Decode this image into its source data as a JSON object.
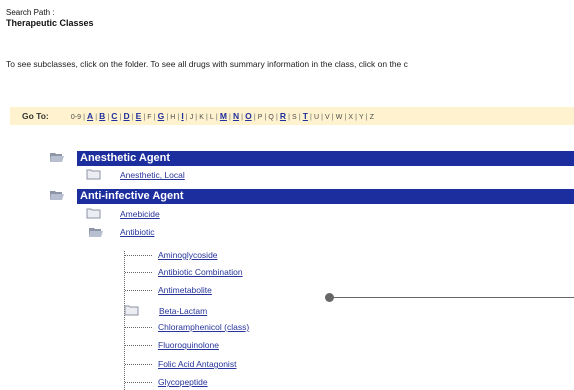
{
  "search_path": {
    "label": "Search Path :",
    "title": "Therapeutic Classes"
  },
  "instruction": "To see subclasses, click on the folder. To see all drugs with summary information in the class, click on the c",
  "goto": {
    "label": "Go To:",
    "letters": [
      {
        "text": "0-9",
        "active": false
      },
      {
        "text": "A",
        "active": true
      },
      {
        "text": "B",
        "active": true
      },
      {
        "text": "C",
        "active": true
      },
      {
        "text": "D",
        "active": true
      },
      {
        "text": "E",
        "active": true
      },
      {
        "text": "F",
        "active": false
      },
      {
        "text": "G",
        "active": true
      },
      {
        "text": "H",
        "active": false
      },
      {
        "text": "I",
        "active": true
      },
      {
        "text": "J",
        "active": false
      },
      {
        "text": "K",
        "active": false
      },
      {
        "text": "L",
        "active": false
      },
      {
        "text": "M",
        "active": true
      },
      {
        "text": "N",
        "active": true
      },
      {
        "text": "O",
        "active": true
      },
      {
        "text": "P",
        "active": false
      },
      {
        "text": "Q",
        "active": false
      },
      {
        "text": "R",
        "active": true
      },
      {
        "text": "S",
        "active": false
      },
      {
        "text": "T",
        "active": true
      },
      {
        "text": "U",
        "active": false
      },
      {
        "text": "V",
        "active": false
      },
      {
        "text": "W",
        "active": false
      },
      {
        "text": "X",
        "active": false
      },
      {
        "text": "Y",
        "active": false
      },
      {
        "text": "Z",
        "active": false
      }
    ]
  },
  "tree": {
    "anesthetic": {
      "title": "Anesthetic Agent",
      "child": "Anesthetic, Local"
    },
    "anti_infective": {
      "title": "Anti-infective Agent",
      "amebicide": "Amebicide",
      "antibiotic": "Antibiotic",
      "subclasses": {
        "aminoglycoside": "Aminoglycoside",
        "antibiotic_combination": "Antibiotic Combination",
        "antimetabolite": "Antimetabolite",
        "beta_lactam": "Beta-Lactam",
        "chloramphenicol": "Chloramphenicol (class)",
        "fluoroquinolone": "Fluoroquinolone",
        "folic_acid": "Folic Acid Antagonist",
        "glycopeptide": "Glycopeptide"
      }
    }
  },
  "colors": {
    "class_bar": "#1c2e9e",
    "link": "#27359b",
    "goto_bar": "#fff3cf",
    "callout": "#666666"
  },
  "icons": {
    "open_folder": "open-folder-icon",
    "closed_folder": "closed-folder-icon",
    "callout": "callout-pointer-icon"
  }
}
